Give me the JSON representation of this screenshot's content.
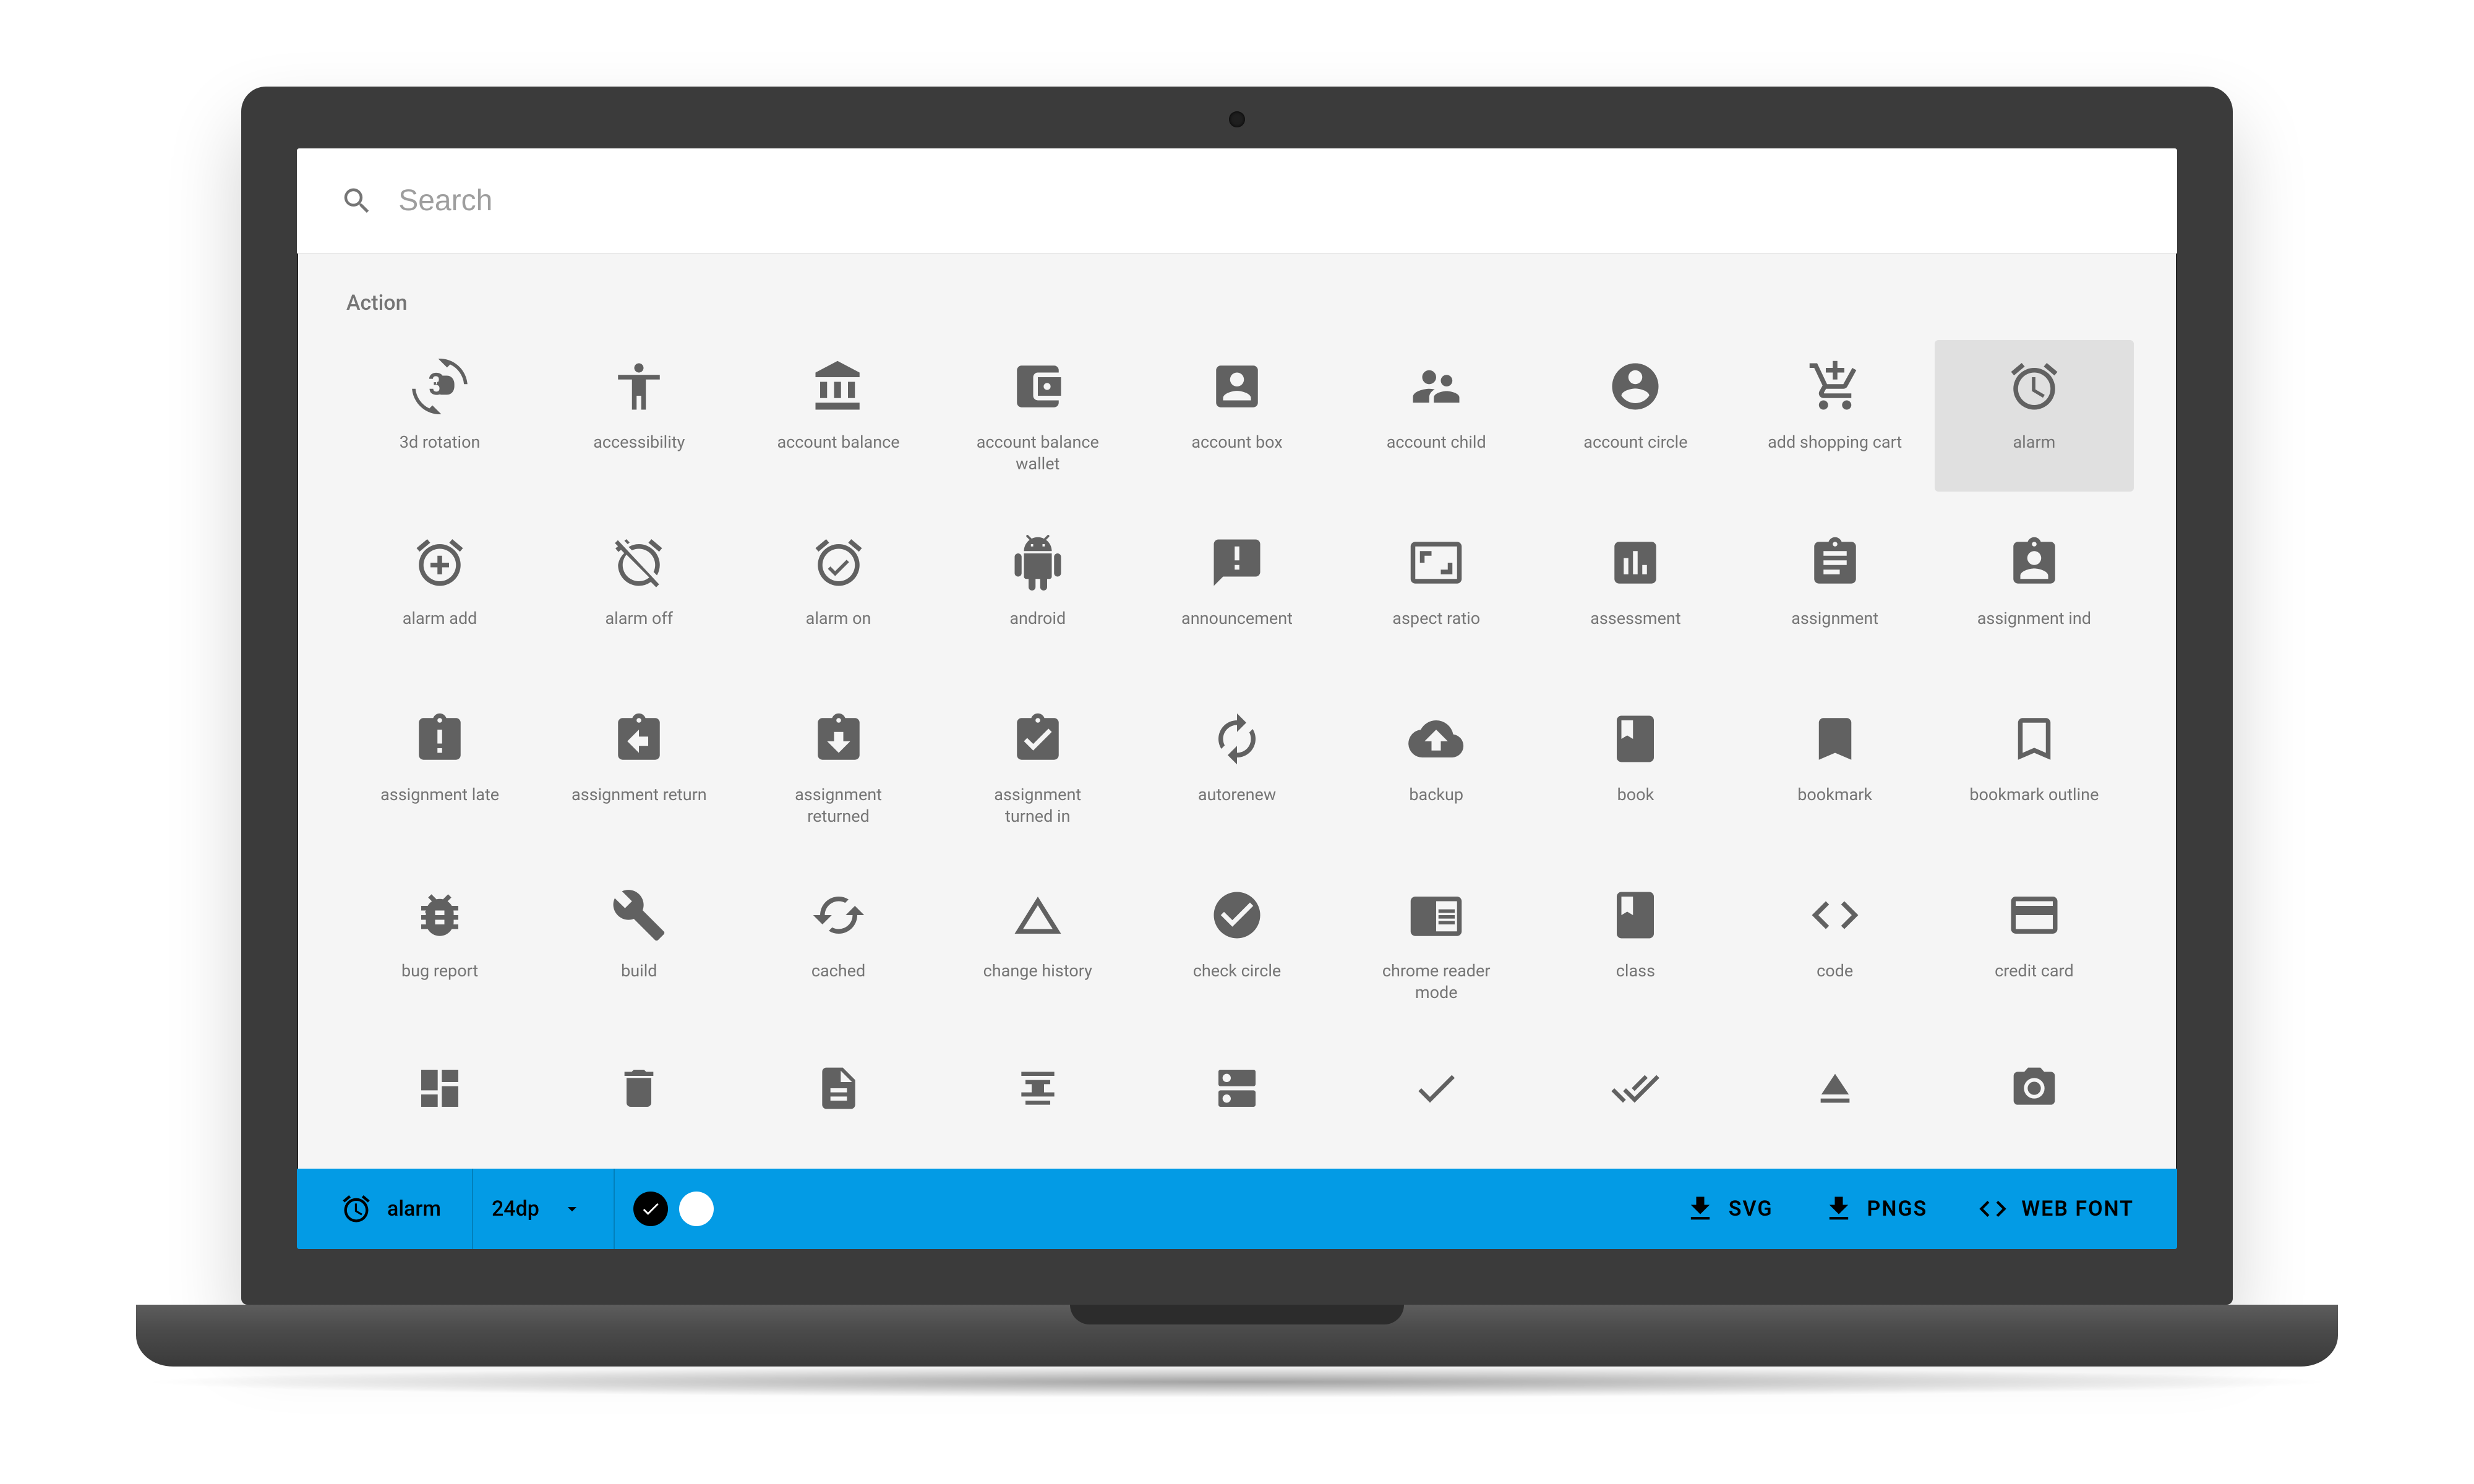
{
  "search": {
    "placeholder": "Search"
  },
  "section": {
    "title": "Action"
  },
  "selected_icon": "alarm",
  "icons": {
    "row1": [
      {
        "id": "3d_rotation",
        "label": "3d rotation"
      },
      {
        "id": "accessibility",
        "label": "accessibility"
      },
      {
        "id": "account_balance",
        "label": "account balance"
      },
      {
        "id": "account_balance_wallet",
        "label": "account balance wallet"
      },
      {
        "id": "account_box",
        "label": "account box"
      },
      {
        "id": "account_child",
        "label": "account child"
      },
      {
        "id": "account_circle",
        "label": "account circle"
      },
      {
        "id": "add_shopping_cart",
        "label": "add shopping cart"
      },
      {
        "id": "alarm",
        "label": "alarm",
        "selected": true
      }
    ],
    "row2": [
      {
        "id": "alarm_add",
        "label": "alarm add"
      },
      {
        "id": "alarm_off",
        "label": "alarm off"
      },
      {
        "id": "alarm_on",
        "label": "alarm on"
      },
      {
        "id": "android",
        "label": "android"
      },
      {
        "id": "announcement",
        "label": "announcement"
      },
      {
        "id": "aspect_ratio",
        "label": "aspect ratio"
      },
      {
        "id": "assessment",
        "label": "assessment"
      },
      {
        "id": "assignment",
        "label": "assignment"
      },
      {
        "id": "assignment_ind",
        "label": "assignment ind"
      }
    ],
    "row3": [
      {
        "id": "assignment_late",
        "label": "assignment late"
      },
      {
        "id": "assignment_return",
        "label": "assignment return"
      },
      {
        "id": "assignment_returned",
        "label": "assignment returned"
      },
      {
        "id": "assignment_turned_in",
        "label": "assignment turned in"
      },
      {
        "id": "autorenew",
        "label": "autorenew"
      },
      {
        "id": "backup",
        "label": "backup"
      },
      {
        "id": "book",
        "label": "book"
      },
      {
        "id": "bookmark",
        "label": "bookmark"
      },
      {
        "id": "bookmark_outline",
        "label": "bookmark outline"
      }
    ],
    "row4": [
      {
        "id": "bug_report",
        "label": "bug report"
      },
      {
        "id": "build",
        "label": "build"
      },
      {
        "id": "cached",
        "label": "cached"
      },
      {
        "id": "change_history",
        "label": "change history"
      },
      {
        "id": "check_circle",
        "label": "check circle"
      },
      {
        "id": "chrome_reader_mode",
        "label": "chrome reader mode"
      },
      {
        "id": "class",
        "label": "class"
      },
      {
        "id": "code",
        "label": "code"
      },
      {
        "id": "credit_card",
        "label": "credit card"
      }
    ],
    "row5": [
      {
        "id": "dashboard"
      },
      {
        "id": "delete"
      },
      {
        "id": "description"
      },
      {
        "id": "dns"
      },
      {
        "id": "done"
      },
      {
        "id": "done_outline"
      },
      {
        "id": "done_all"
      },
      {
        "id": "eject"
      },
      {
        "id": "camera"
      }
    ]
  },
  "action_bar": {
    "selected_label": "alarm",
    "size_label": "24dp",
    "colors": {
      "black_selected": true
    },
    "svg_label": "SVG",
    "pngs_label": "PNGS",
    "webfont_label": "WEB FONT"
  }
}
